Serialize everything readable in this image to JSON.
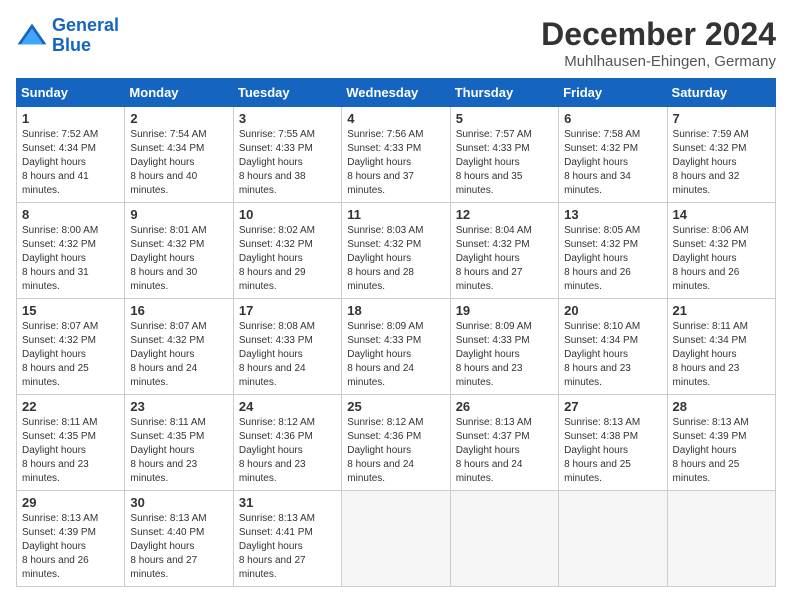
{
  "logo": {
    "line1": "General",
    "line2": "Blue"
  },
  "title": "December 2024",
  "subtitle": "Muhlhausen-Ehingen, Germany",
  "days_header": [
    "Sunday",
    "Monday",
    "Tuesday",
    "Wednesday",
    "Thursday",
    "Friday",
    "Saturday"
  ],
  "weeks": [
    [
      {
        "day": "1",
        "sunrise": "7:52 AM",
        "sunset": "4:34 PM",
        "daylight": "8 hours and 41 minutes."
      },
      {
        "day": "2",
        "sunrise": "7:54 AM",
        "sunset": "4:34 PM",
        "daylight": "8 hours and 40 minutes."
      },
      {
        "day": "3",
        "sunrise": "7:55 AM",
        "sunset": "4:33 PM",
        "daylight": "8 hours and 38 minutes."
      },
      {
        "day": "4",
        "sunrise": "7:56 AM",
        "sunset": "4:33 PM",
        "daylight": "8 hours and 37 minutes."
      },
      {
        "day": "5",
        "sunrise": "7:57 AM",
        "sunset": "4:33 PM",
        "daylight": "8 hours and 35 minutes."
      },
      {
        "day": "6",
        "sunrise": "7:58 AM",
        "sunset": "4:32 PM",
        "daylight": "8 hours and 34 minutes."
      },
      {
        "day": "7",
        "sunrise": "7:59 AM",
        "sunset": "4:32 PM",
        "daylight": "8 hours and 32 minutes."
      }
    ],
    [
      {
        "day": "8",
        "sunrise": "8:00 AM",
        "sunset": "4:32 PM",
        "daylight": "8 hours and 31 minutes."
      },
      {
        "day": "9",
        "sunrise": "8:01 AM",
        "sunset": "4:32 PM",
        "daylight": "8 hours and 30 minutes."
      },
      {
        "day": "10",
        "sunrise": "8:02 AM",
        "sunset": "4:32 PM",
        "daylight": "8 hours and 29 minutes."
      },
      {
        "day": "11",
        "sunrise": "8:03 AM",
        "sunset": "4:32 PM",
        "daylight": "8 hours and 28 minutes."
      },
      {
        "day": "12",
        "sunrise": "8:04 AM",
        "sunset": "4:32 PM",
        "daylight": "8 hours and 27 minutes."
      },
      {
        "day": "13",
        "sunrise": "8:05 AM",
        "sunset": "4:32 PM",
        "daylight": "8 hours and 26 minutes."
      },
      {
        "day": "14",
        "sunrise": "8:06 AM",
        "sunset": "4:32 PM",
        "daylight": "8 hours and 26 minutes."
      }
    ],
    [
      {
        "day": "15",
        "sunrise": "8:07 AM",
        "sunset": "4:32 PM",
        "daylight": "8 hours and 25 minutes."
      },
      {
        "day": "16",
        "sunrise": "8:07 AM",
        "sunset": "4:32 PM",
        "daylight": "8 hours and 24 minutes."
      },
      {
        "day": "17",
        "sunrise": "8:08 AM",
        "sunset": "4:33 PM",
        "daylight": "8 hours and 24 minutes."
      },
      {
        "day": "18",
        "sunrise": "8:09 AM",
        "sunset": "4:33 PM",
        "daylight": "8 hours and 24 minutes."
      },
      {
        "day": "19",
        "sunrise": "8:09 AM",
        "sunset": "4:33 PM",
        "daylight": "8 hours and 23 minutes."
      },
      {
        "day": "20",
        "sunrise": "8:10 AM",
        "sunset": "4:34 PM",
        "daylight": "8 hours and 23 minutes."
      },
      {
        "day": "21",
        "sunrise": "8:11 AM",
        "sunset": "4:34 PM",
        "daylight": "8 hours and 23 minutes."
      }
    ],
    [
      {
        "day": "22",
        "sunrise": "8:11 AM",
        "sunset": "4:35 PM",
        "daylight": "8 hours and 23 minutes."
      },
      {
        "day": "23",
        "sunrise": "8:11 AM",
        "sunset": "4:35 PM",
        "daylight": "8 hours and 23 minutes."
      },
      {
        "day": "24",
        "sunrise": "8:12 AM",
        "sunset": "4:36 PM",
        "daylight": "8 hours and 23 minutes."
      },
      {
        "day": "25",
        "sunrise": "8:12 AM",
        "sunset": "4:36 PM",
        "daylight": "8 hours and 24 minutes."
      },
      {
        "day": "26",
        "sunrise": "8:13 AM",
        "sunset": "4:37 PM",
        "daylight": "8 hours and 24 minutes."
      },
      {
        "day": "27",
        "sunrise": "8:13 AM",
        "sunset": "4:38 PM",
        "daylight": "8 hours and 25 minutes."
      },
      {
        "day": "28",
        "sunrise": "8:13 AM",
        "sunset": "4:39 PM",
        "daylight": "8 hours and 25 minutes."
      }
    ],
    [
      {
        "day": "29",
        "sunrise": "8:13 AM",
        "sunset": "4:39 PM",
        "daylight": "8 hours and 26 minutes."
      },
      {
        "day": "30",
        "sunrise": "8:13 AM",
        "sunset": "4:40 PM",
        "daylight": "8 hours and 27 minutes."
      },
      {
        "day": "31",
        "sunrise": "8:13 AM",
        "sunset": "4:41 PM",
        "daylight": "8 hours and 27 minutes."
      },
      null,
      null,
      null,
      null
    ]
  ]
}
